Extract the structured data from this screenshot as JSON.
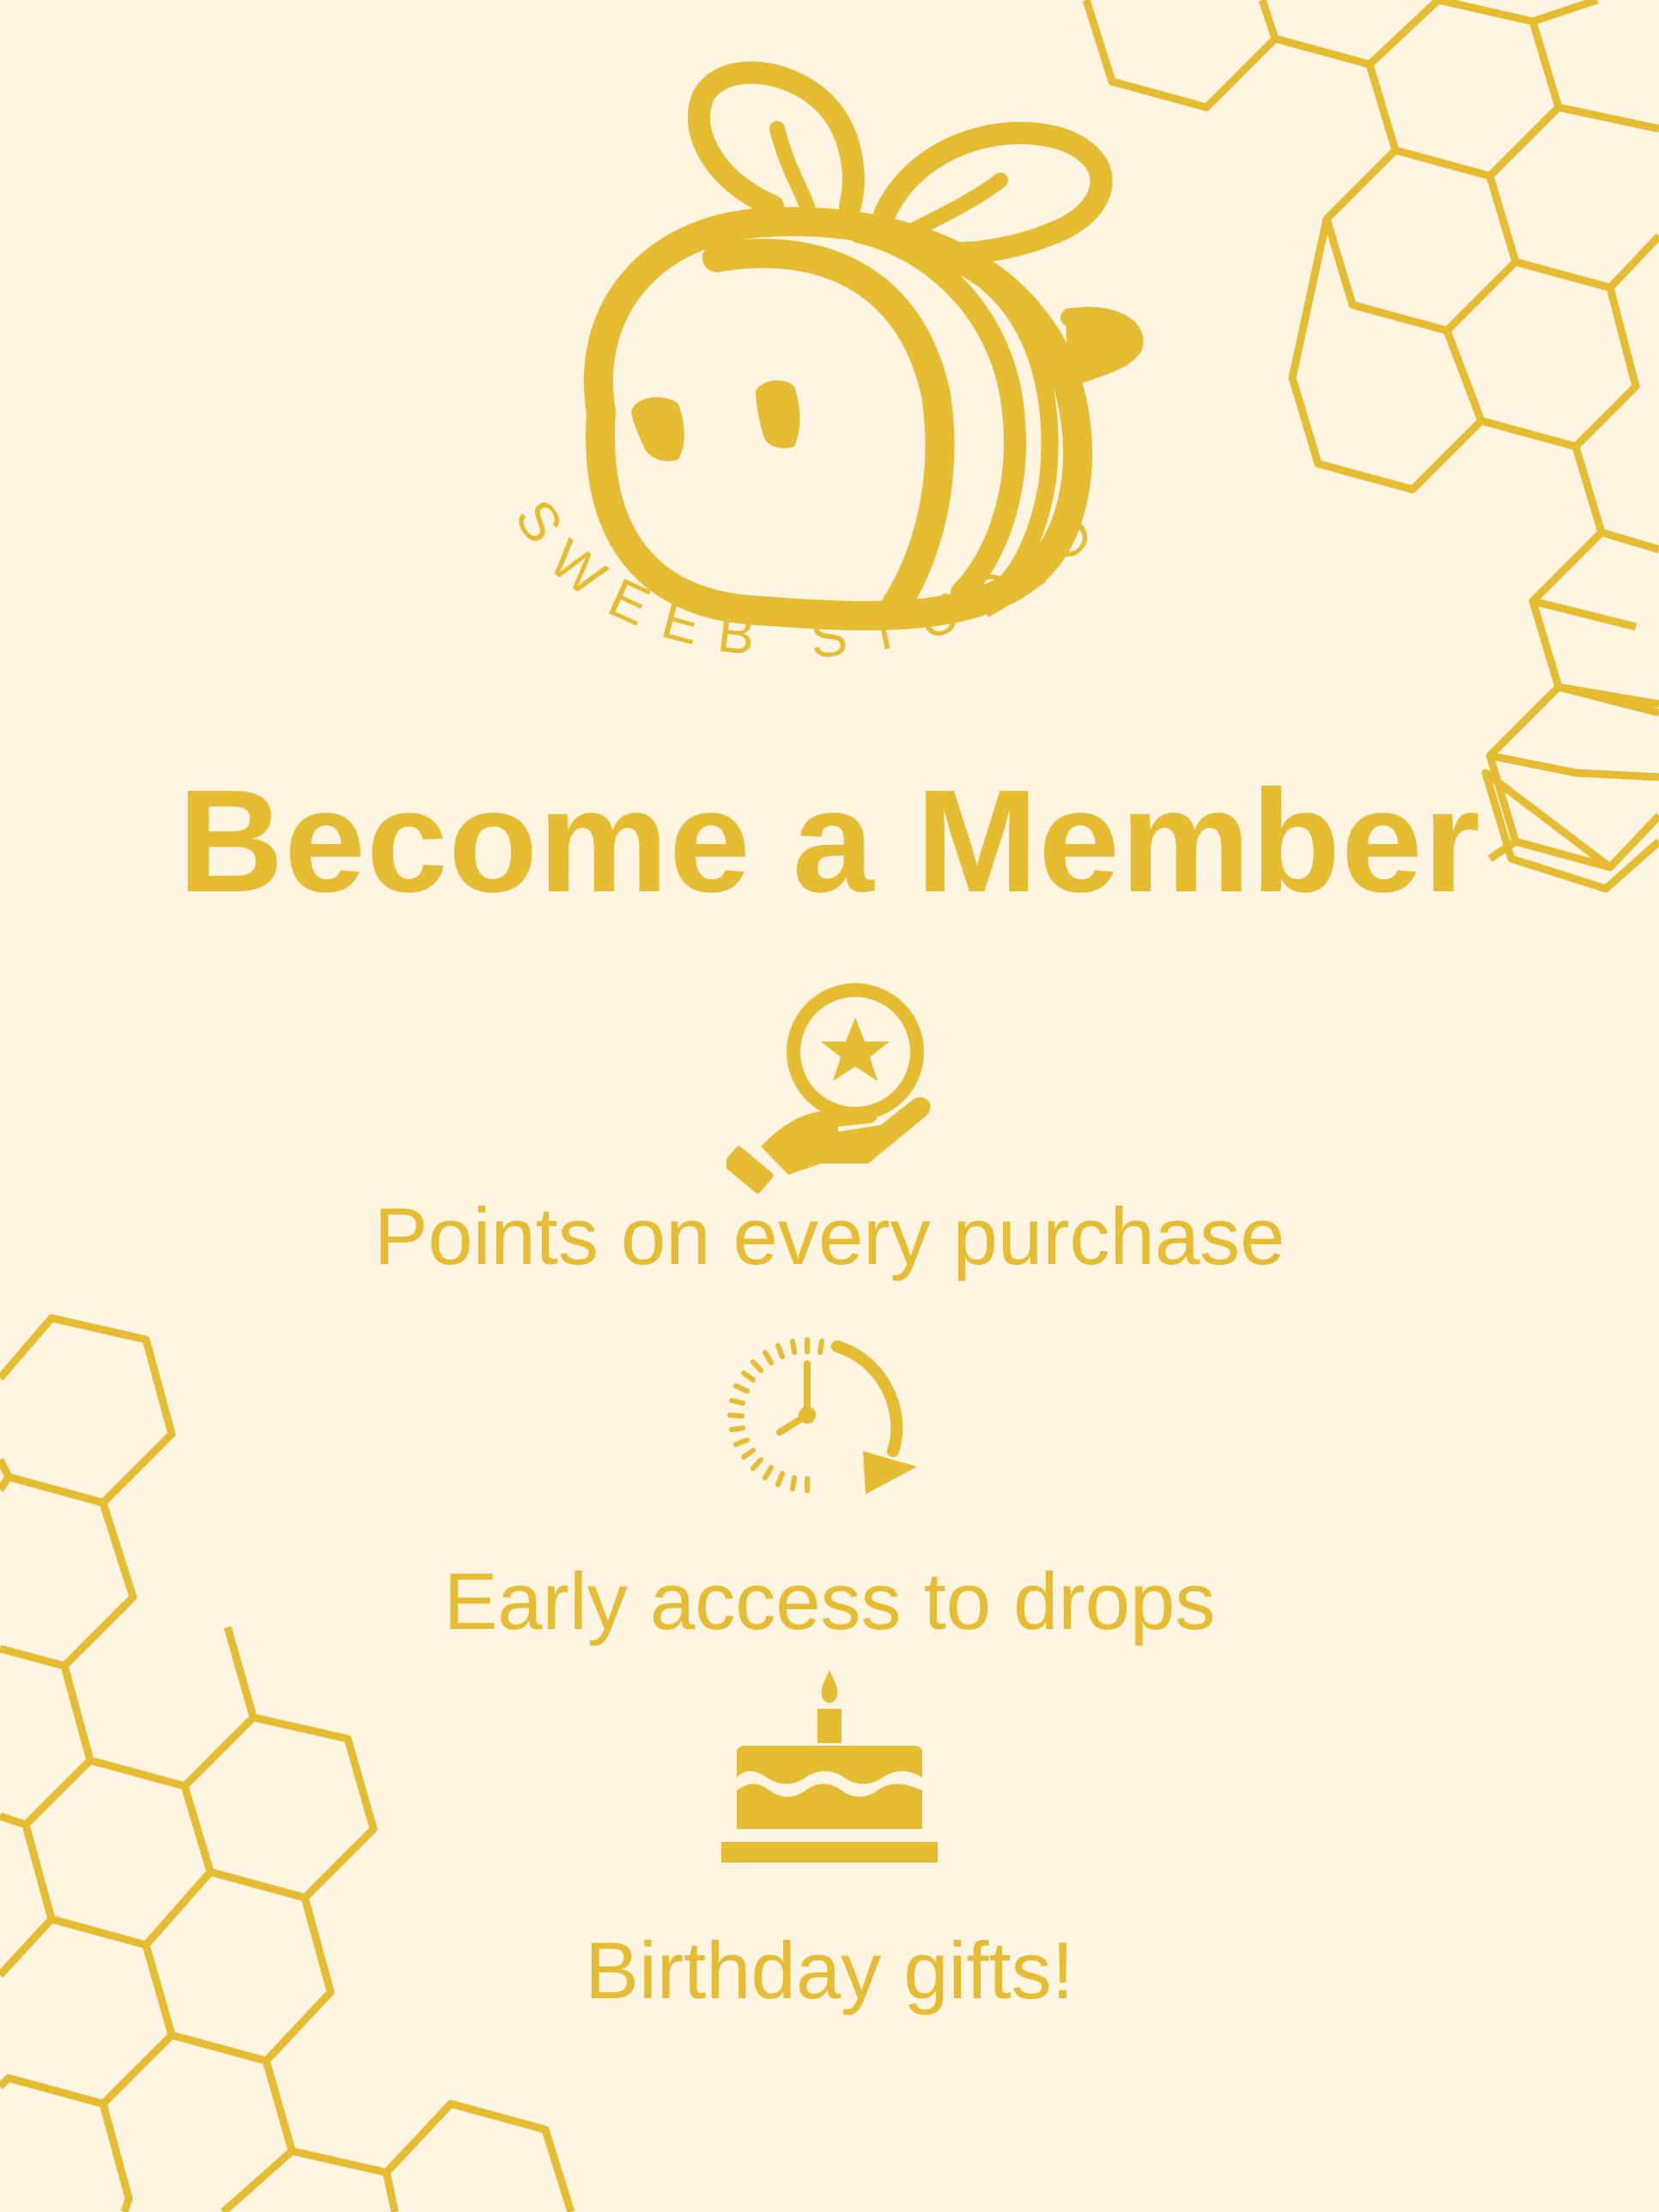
{
  "colors": {
    "background": "#fdf4e2",
    "accent": "#e6bc32"
  },
  "brand": {
    "logo_text": "SWEEB STUDIO"
  },
  "title": "Become a Member",
  "benefits": [
    {
      "icon": "hand-coin-star-icon",
      "label": "Points on every purchase"
    },
    {
      "icon": "clock-arrow-icon",
      "label": "Early access to drops"
    },
    {
      "icon": "birthday-cake-icon",
      "label": "Birthday gifts!"
    }
  ]
}
